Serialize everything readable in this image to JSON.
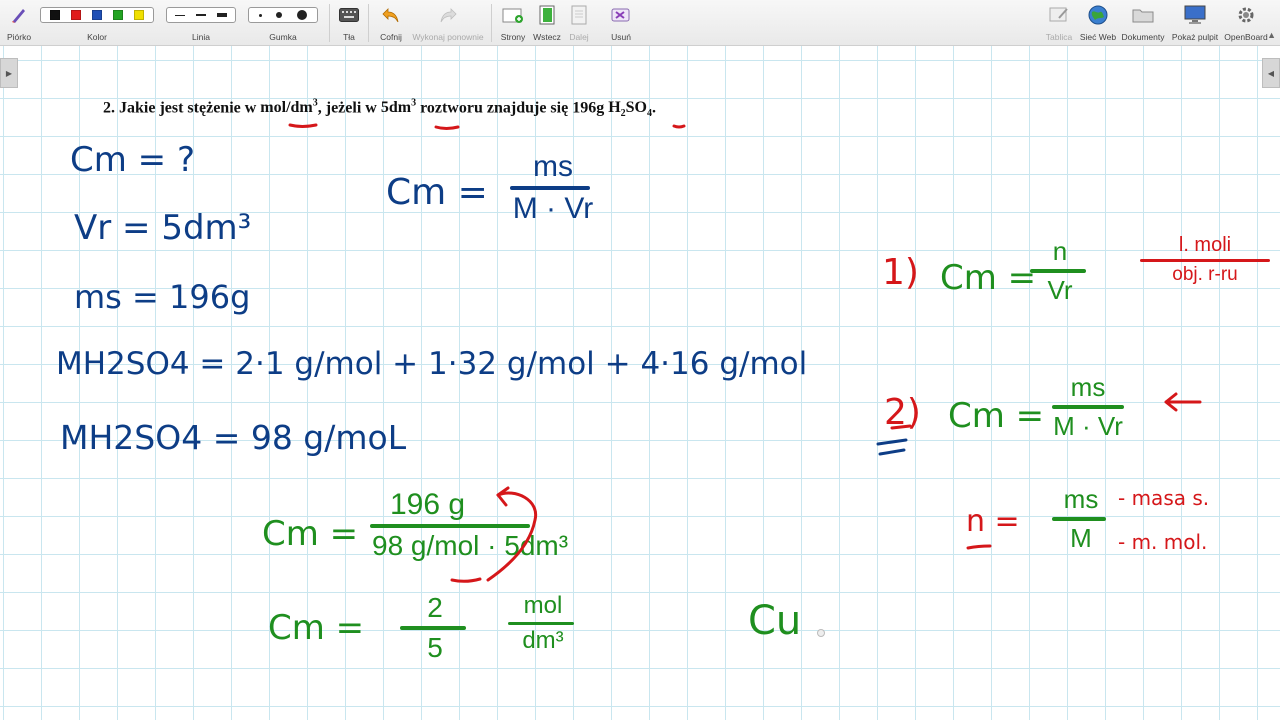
{
  "toolbar": {
    "pen": "Piórko",
    "color": "Kolor",
    "line": "Linia",
    "eraser": "Gumka",
    "background": "Tła",
    "undo": "Cofnij",
    "redo": "Wykonaj ponownie",
    "pages": "Strony",
    "back": "Wstecz",
    "next": "Dalej",
    "delete": "Usuń",
    "board": "Tablica",
    "web": "Sieć Web",
    "documents": "Dokumenty",
    "desktop": "Pokaż pulpit",
    "openboard": "OpenBoard",
    "colors": [
      "#111111",
      "#e01b1b",
      "#1f4fb5",
      "#22a322",
      "#f0e000"
    ]
  },
  "question": {
    "number": "2.",
    "part1": "Jakie jest stężenie w",
    "unit1": "mol/dm",
    "part2": ", jeżeli w",
    "vol": "5dm",
    "part3": "roztworu znajduje się",
    "mass": "196g",
    "formula_h": "H",
    "formula_2": "2",
    "formula_so": "SO",
    "formula_4": "4",
    "end": "."
  },
  "ink": {
    "cm_q": "Cm = ?",
    "vr": "Vr = 5dm³",
    "ms": "ms = 196g",
    "mh2so4_1": "MH2SO4 = 2·1 g/mol + 1·32 g/mol + 4·16 g/mol",
    "mh2so4_2": "MH2SO4 = 98 g/moL",
    "cm_main_left": "Cm =",
    "cm_main_num": "ms",
    "cm_main_den": "M · Vr",
    "calc1_left": "Cm =",
    "calc1_num": "196 g",
    "calc1_den": "98 g/mol · 5dm³",
    "calc2_left": "Cm =",
    "calc2_num": "2",
    "calc2_den": "5",
    "calc2_unit_num": "mol",
    "calc2_unit_den": "dm³",
    "cm_partial": "Cu",
    "r1_label": "1)",
    "r1_left": "Cm =",
    "r1_num": "n",
    "r1_den": "Vr",
    "r1_note_num": "l. moli",
    "r1_note_den": "obj. r-ru",
    "r2_label": "2)",
    "r2_left": "Cm =",
    "r2_num": "ms",
    "r2_den": "M · Vr",
    "r3_left": "n =",
    "r3_num": "ms",
    "r3_den": "M",
    "r3_note1": "- masa s.",
    "r3_note2": "- m. mol."
  }
}
